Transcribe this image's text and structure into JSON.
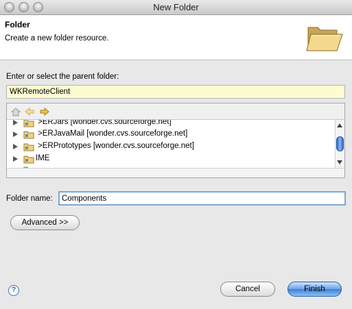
{
  "window": {
    "title": "New Folder"
  },
  "header": {
    "title": "Folder",
    "description": "Create a new folder resource.",
    "icon": "open-folder-icon"
  },
  "parent": {
    "label": "Enter or select the parent folder:",
    "value": "WKRemoteClient"
  },
  "tree": {
    "toolbar": [
      "home-icon",
      "back-icon",
      "forward-icon"
    ],
    "items": [
      {
        "label": ">ERJars  [wonder.cvs.sourceforge.net]",
        "icon": "project-folder-icon"
      },
      {
        "label": ">ERJavaMail  [wonder.cvs.sourceforge.net]",
        "icon": "project-folder-icon"
      },
      {
        "label": ">ERPrototypes  [wonder.cvs.sourceforge.net]",
        "icon": "project-folder-icon"
      },
      {
        "label": "IME",
        "icon": "project-folder-icon"
      },
      {
        "label": "",
        "icon": "project-folder-icon"
      }
    ]
  },
  "folder_name": {
    "label": "Folder name:",
    "value": "Components"
  },
  "buttons": {
    "advanced": "Advanced >>",
    "cancel": "Cancel",
    "finish": "Finish"
  },
  "help": {
    "icon": "help-icon",
    "symbol": "?"
  },
  "colors": {
    "accent": "#3d7fd6",
    "input_highlight": "#fdfbd0"
  }
}
